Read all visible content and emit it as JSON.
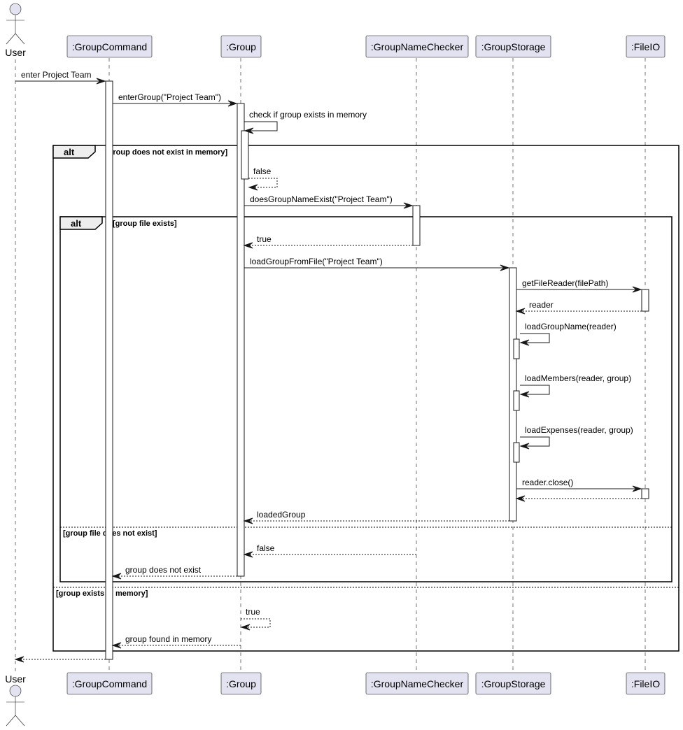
{
  "diagram": {
    "type": "sequence",
    "actors": [
      {
        "id": "user",
        "label": "User",
        "kind": "actor"
      },
      {
        "id": "gc",
        "label": ":GroupCommand",
        "kind": "participant"
      },
      {
        "id": "g",
        "label": ":Group",
        "kind": "participant"
      },
      {
        "id": "gnc",
        "label": ":GroupNameChecker",
        "kind": "participant"
      },
      {
        "id": "gs",
        "label": ":GroupStorage",
        "kind": "participant"
      },
      {
        "id": "fio",
        "label": ":FileIO",
        "kind": "participant"
      }
    ],
    "messages": [
      {
        "from": "user",
        "to": "gc",
        "label": "enter Project Team",
        "style": "sync"
      },
      {
        "from": "gc",
        "to": "g",
        "label": "enterGroup(\"Project Team\")",
        "style": "sync"
      },
      {
        "from": "g",
        "to": "g",
        "label": "check if group exists in memory",
        "style": "self"
      },
      {
        "from": "g",
        "to": "g",
        "label": "false",
        "style": "self-return"
      },
      {
        "from": "g",
        "to": "gnc",
        "label": "doesGroupNameExist(\"Project Team\")",
        "style": "sync"
      },
      {
        "from": "gnc",
        "to": "g",
        "label": "true",
        "style": "return"
      },
      {
        "from": "g",
        "to": "gs",
        "label": "loadGroupFromFile(\"Project Team\")",
        "style": "sync"
      },
      {
        "from": "gs",
        "to": "fio",
        "label": "getFileReader(filePath)",
        "style": "sync"
      },
      {
        "from": "fio",
        "to": "gs",
        "label": "reader",
        "style": "return"
      },
      {
        "from": "gs",
        "to": "gs",
        "label": "loadGroupName(reader)",
        "style": "self"
      },
      {
        "from": "gs",
        "to": "gs",
        "label": "loadMembers(reader, group)",
        "style": "self"
      },
      {
        "from": "gs",
        "to": "gs",
        "label": "loadExpenses(reader, group)",
        "style": "self"
      },
      {
        "from": "gs",
        "to": "fio",
        "label": "reader.close()",
        "style": "sync"
      },
      {
        "from": "fio",
        "to": "gs",
        "label": "",
        "style": "return"
      },
      {
        "from": "gs",
        "to": "g",
        "label": "loadedGroup",
        "style": "return"
      },
      {
        "from": "gnc",
        "to": "g",
        "label": "false",
        "style": "return"
      },
      {
        "from": "g",
        "to": "gc",
        "label": "group does not exist",
        "style": "return"
      },
      {
        "from": "g",
        "to": "g",
        "label": "true",
        "style": "self-return"
      },
      {
        "from": "g",
        "to": "gc",
        "label": "group found in memory",
        "style": "return"
      },
      {
        "from": "gc",
        "to": "user",
        "label": "",
        "style": "return"
      }
    ],
    "fragments": [
      {
        "operator": "alt",
        "guards": [
          "[group does not exist in memory]",
          "[group exists in memory]"
        ]
      },
      {
        "operator": "alt",
        "guards": [
          "[group file exists]",
          "[group file does not exist]"
        ]
      }
    ]
  }
}
